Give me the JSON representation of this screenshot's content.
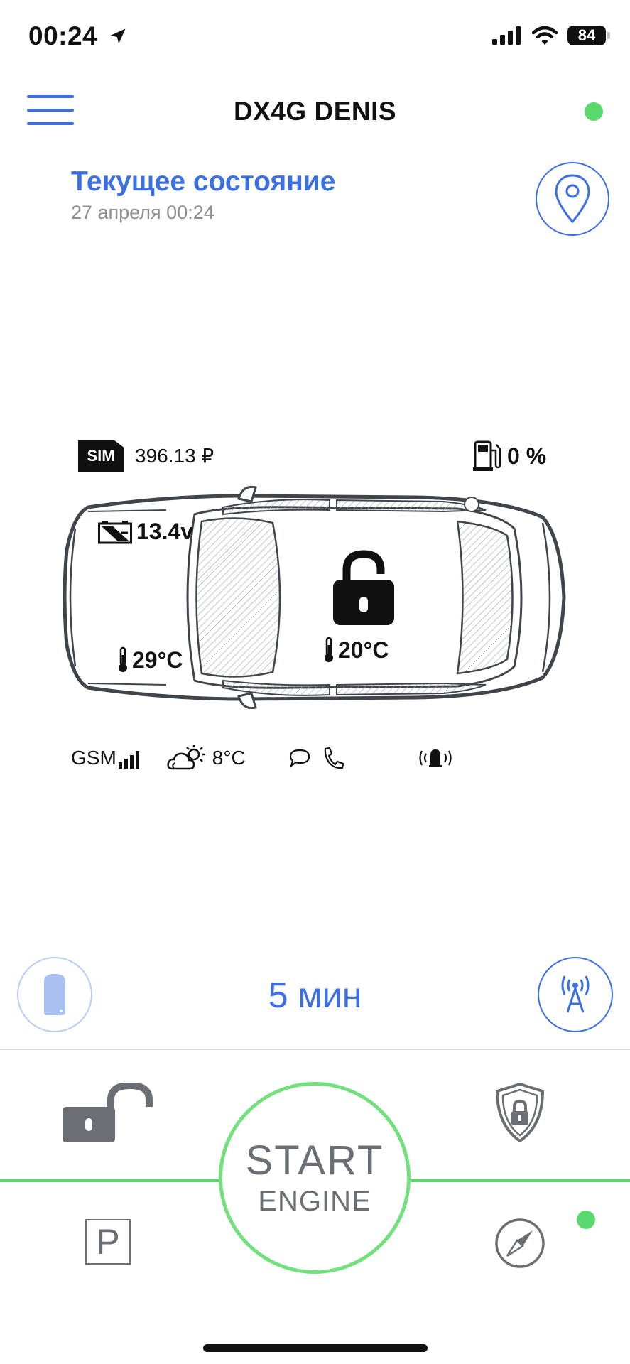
{
  "status_bar": {
    "time": "00:24",
    "battery": "84"
  },
  "header": {
    "title": "DX4G DENIS"
  },
  "state": {
    "title": "Текущее состояние",
    "date": "27 апреля 00:24"
  },
  "car": {
    "sim_label": "SIM",
    "sim_balance": "396.13 ₽",
    "fuel": "0 %",
    "voltage": "13.4v",
    "engine_temp": "29°C",
    "cabin_temp": "20°C",
    "lock_state": "unlocked"
  },
  "indicators": {
    "gsm": "GSM",
    "weather_temp": "8°C"
  },
  "timer": "5 мин",
  "start": {
    "line1": "START",
    "line2": "ENGINE"
  },
  "parking_label": "P",
  "colors": {
    "accent": "#3a6fe6",
    "online": "#59d86b",
    "start_ring": "#73e07e",
    "icon_gray": "#6b6f75"
  }
}
